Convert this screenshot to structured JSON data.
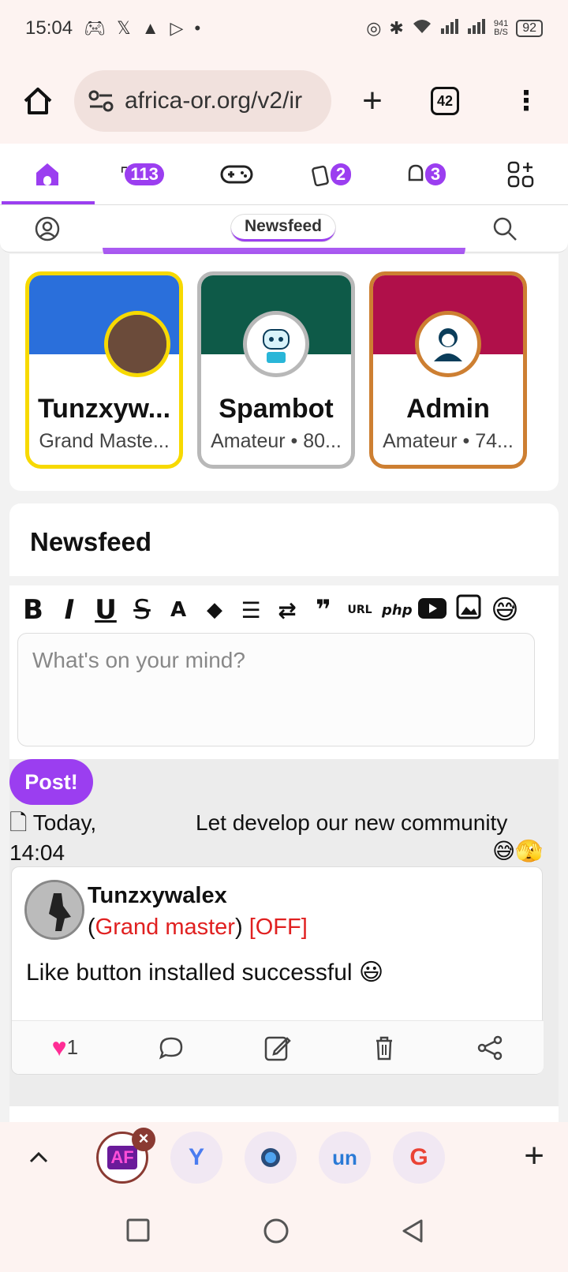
{
  "status_bar": {
    "time": "15:04",
    "net_speed_value": "941",
    "net_speed_unit": "B/S",
    "battery": "92"
  },
  "browser": {
    "url": "africa-or.org/v2/ir",
    "tab_count": "42"
  },
  "site_nav": {
    "badge_messages": "113",
    "badge_posts": "2",
    "badge_notifications": "3"
  },
  "subnav": {
    "active": "Newsfeed"
  },
  "users": [
    {
      "name": "Tunzxyw...",
      "rank": "Grand Maste...",
      "border": "#f7d900",
      "banner": "#2a6fdb"
    },
    {
      "name": "Spambot",
      "rank": "Amateur • 80...",
      "border": "#b8b8b8",
      "banner": "#0e5a48"
    },
    {
      "name": "Admin",
      "rank": "Amateur • 74...",
      "border": "#cd7f32",
      "banner": "#b0104a"
    }
  ],
  "feed": {
    "title": "Newsfeed",
    "composer_placeholder": "What's on your mind?",
    "post_button": "Post!",
    "status_date": "Today, 14:04",
    "status_message": "Let develop our new community",
    "status_emoji": "😅🫣"
  },
  "post": {
    "author": "Tunzxywalex",
    "rank": "Grand master",
    "online": "[OFF]",
    "text": "Like button installed successful 😃",
    "likes": "1"
  },
  "colors": {
    "accent": "#9b3ef0",
    "offline": "#e02020"
  }
}
